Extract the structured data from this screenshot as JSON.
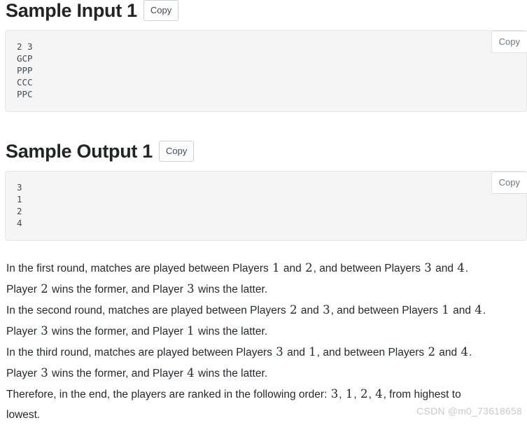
{
  "sections": [
    {
      "title": "Sample Input 1",
      "copy_label": "Copy",
      "code_copy_label": "Copy",
      "code": "2 3\nGCP\nPPP\nCCC\nPPC"
    },
    {
      "title": "Sample Output 1",
      "copy_label": "Copy",
      "code_copy_label": "Copy",
      "code": "3\n1\n2\n4"
    }
  ],
  "explanation": {
    "lines": [
      [
        {
          "t": "text",
          "v": "In the first round, matches are played between Players "
        },
        {
          "t": "num",
          "v": "1"
        },
        {
          "t": "text",
          "v": " and "
        },
        {
          "t": "num",
          "v": "2"
        },
        {
          "t": "text",
          "v": ", and between Players "
        },
        {
          "t": "num",
          "v": "3"
        },
        {
          "t": "text",
          "v": " and "
        },
        {
          "t": "num",
          "v": "4"
        },
        {
          "t": "text",
          "v": "."
        }
      ],
      [
        {
          "t": "text",
          "v": "Player "
        },
        {
          "t": "num",
          "v": "2"
        },
        {
          "t": "text",
          "v": " wins the former, and Player "
        },
        {
          "t": "num",
          "v": "3"
        },
        {
          "t": "text",
          "v": " wins the latter."
        }
      ],
      [
        {
          "t": "text",
          "v": "In the second round, matches are played between Players "
        },
        {
          "t": "num",
          "v": "2"
        },
        {
          "t": "text",
          "v": " and "
        },
        {
          "t": "num",
          "v": "3"
        },
        {
          "t": "text",
          "v": ", and between Players "
        },
        {
          "t": "num",
          "v": "1"
        },
        {
          "t": "text",
          "v": " and "
        },
        {
          "t": "num",
          "v": "4"
        },
        {
          "t": "text",
          "v": "."
        }
      ],
      [
        {
          "t": "text",
          "v": "Player "
        },
        {
          "t": "num",
          "v": "3"
        },
        {
          "t": "text",
          "v": " wins the former, and Player "
        },
        {
          "t": "num",
          "v": "1"
        },
        {
          "t": "text",
          "v": " wins the latter."
        }
      ],
      [
        {
          "t": "text",
          "v": "In the third round, matches are played between Players "
        },
        {
          "t": "num",
          "v": "3"
        },
        {
          "t": "text",
          "v": " and "
        },
        {
          "t": "num",
          "v": "1"
        },
        {
          "t": "text",
          "v": ", and between Players "
        },
        {
          "t": "num",
          "v": "2"
        },
        {
          "t": "text",
          "v": " and "
        },
        {
          "t": "num",
          "v": "4"
        },
        {
          "t": "text",
          "v": "."
        }
      ],
      [
        {
          "t": "text",
          "v": "Player "
        },
        {
          "t": "num",
          "v": "3"
        },
        {
          "t": "text",
          "v": " wins the former, and Player "
        },
        {
          "t": "num",
          "v": "4"
        },
        {
          "t": "text",
          "v": " wins the latter."
        }
      ],
      [
        {
          "t": "text",
          "v": "Therefore, in the end, the players are ranked in the following order: "
        },
        {
          "t": "num",
          "v": "3"
        },
        {
          "t": "text",
          "v": ", "
        },
        {
          "t": "num",
          "v": "1"
        },
        {
          "t": "text",
          "v": ", "
        },
        {
          "t": "num",
          "v": "2"
        },
        {
          "t": "text",
          "v": ", "
        },
        {
          "t": "num",
          "v": "4"
        },
        {
          "t": "text",
          "v": ", from highest to"
        }
      ],
      [
        {
          "t": "text",
          "v": "lowest."
        }
      ]
    ]
  },
  "watermark": "CSDN @m0_73618658",
  "colors": {
    "code_bg": "#f5f5f5",
    "code_border": "#e6e6e6",
    "code_text": "#3f4b5b",
    "heading": "#222426",
    "body_text": "#24292f",
    "watermark": "#c9c9c9"
  }
}
